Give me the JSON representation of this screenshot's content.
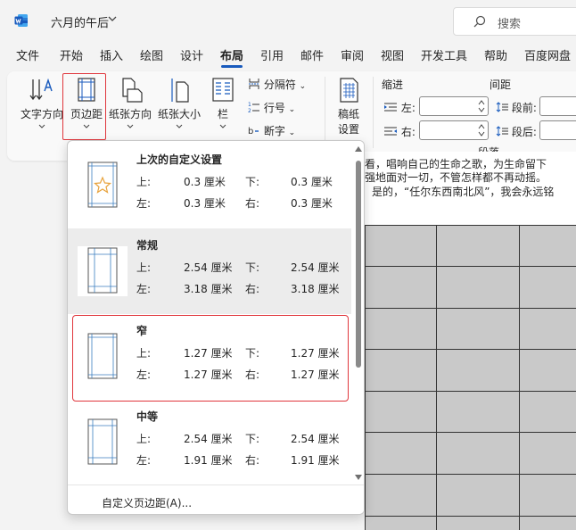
{
  "titlebar": {
    "doc_title": "六月的午后",
    "search_placeholder": "搜索"
  },
  "tabs": [
    "文件",
    "开始",
    "插入",
    "绘图",
    "设计",
    "布局",
    "引用",
    "邮件",
    "审阅",
    "视图",
    "开发工具",
    "帮助",
    "百度网盘"
  ],
  "active_tab": "布局",
  "ribbon": {
    "text_direction": "文字方向",
    "margins": "页边距",
    "orientation": "纸张方向",
    "size": "纸张大小",
    "columns": "栏",
    "breaks": "分隔符",
    "line_numbers": "行号",
    "hyphenation": "断字",
    "draft_paper_1": "稿纸",
    "draft_paper_2": "设置",
    "indent_title": "缩进",
    "indent_left": "左:",
    "indent_right": "右:",
    "spacing_title": "间距",
    "spacing_before": "段前:",
    "spacing_after": "段后:",
    "paragraph_group": "段落"
  },
  "document": {
    "line1": "看，唱响自己的生命之歌，为生命留下",
    "line2": "强地面对一切，不管怎样都不再动摇。",
    "line3": "是的，“任尔东西南北风”，我会永远铭"
  },
  "margins_menu": {
    "options": [
      {
        "name": "上次的自定义设置",
        "top_label": "上:",
        "top": "0.3 厘米",
        "bottom_label": "下:",
        "bottom": "0.3 厘米",
        "left_label": "左:",
        "left": "0.3 厘米",
        "right_label": "右:",
        "right": "0.3 厘米"
      },
      {
        "name": "常规",
        "top_label": "上:",
        "top": "2.54 厘米",
        "bottom_label": "下:",
        "bottom": "2.54 厘米",
        "left_label": "左:",
        "left": "3.18 厘米",
        "right_label": "右:",
        "right": "3.18 厘米"
      },
      {
        "name": "窄",
        "top_label": "上:",
        "top": "1.27 厘米",
        "bottom_label": "下:",
        "bottom": "1.27 厘米",
        "left_label": "左:",
        "left": "1.27 厘米",
        "right_label": "右:",
        "right": "1.27 厘米"
      },
      {
        "name": "中等",
        "top_label": "上:",
        "top": "2.54 厘米",
        "bottom_label": "下:",
        "bottom": "2.54 厘米",
        "left_label": "左:",
        "left": "1.91 厘米",
        "right_label": "右:",
        "right": "1.91 厘米"
      }
    ],
    "custom": "自定义页边距(A)..."
  },
  "colors": {
    "accent": "#185abd",
    "highlight": "#e0363c"
  }
}
